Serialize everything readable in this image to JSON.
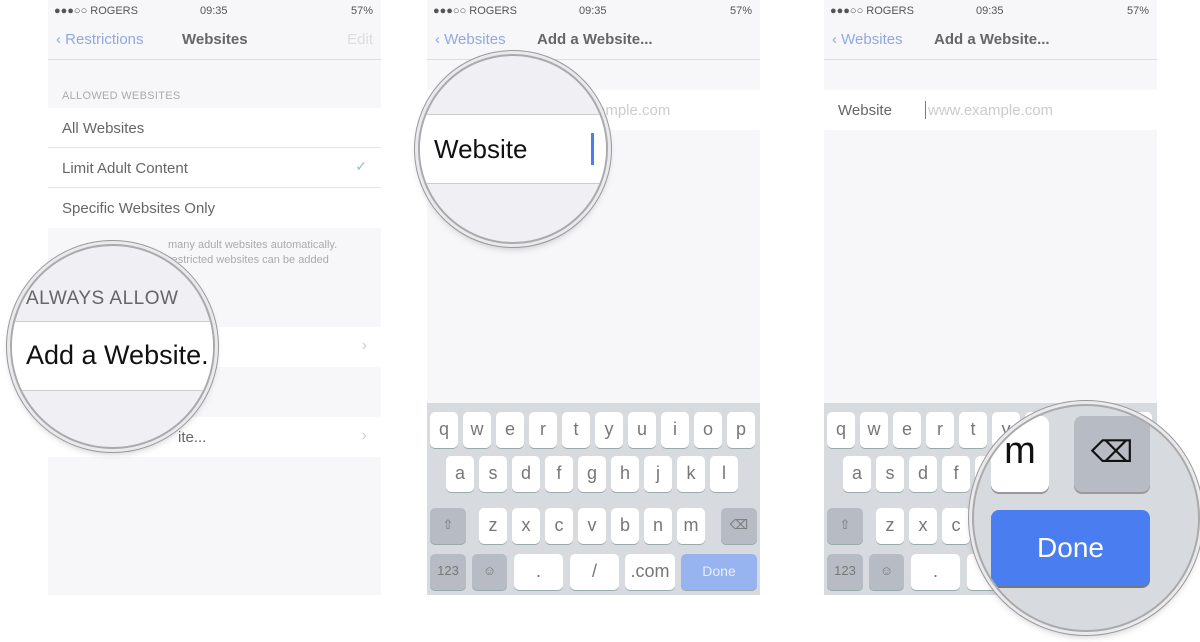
{
  "status": {
    "carrier": "●●●○○ ROGERS",
    "time": "09:35",
    "battery": "57%"
  },
  "panel1": {
    "back": "Restrictions",
    "title": "Websites",
    "edit": "Edit",
    "section": "ALLOWED WEBSITES",
    "options": [
      "All Websites",
      "Limit Adult Content",
      "Specific Websites Only"
    ],
    "selected": 1,
    "footer_visible": "many adult websites automatically.",
    "footer_visible2": "restricted websites can be added",
    "row2_visible": "ite...",
    "magnifier": {
      "header": "ALWAYS ALLOW",
      "row": "Add a Website."
    }
  },
  "panel2": {
    "back": "Websites",
    "title": "Add a Website...",
    "field_placeholder_visible": "ample.com",
    "magnifier": {
      "label": "Website"
    }
  },
  "panel3": {
    "back": "Websites",
    "title": "Add a Website...",
    "field_label": "Website",
    "field_placeholder": "www.example.com",
    "magnifier": {
      "key": "m",
      "done": "Done"
    }
  },
  "keyboard": {
    "row1": [
      "q",
      "w",
      "e",
      "r",
      "t",
      "y",
      "u",
      "i",
      "o",
      "p"
    ],
    "row2": [
      "a",
      "s",
      "d",
      "f",
      "g",
      "h",
      "j",
      "k",
      "l"
    ],
    "row3": [
      "z",
      "x",
      "c",
      "v",
      "b",
      "n",
      "m"
    ],
    "numbers": "123",
    "dot": ".",
    "slash": "/",
    "com": ".com",
    "done": "Done"
  },
  "colors": {
    "accent": "#4a7ef0",
    "done_disabled": "#97b3f0"
  }
}
